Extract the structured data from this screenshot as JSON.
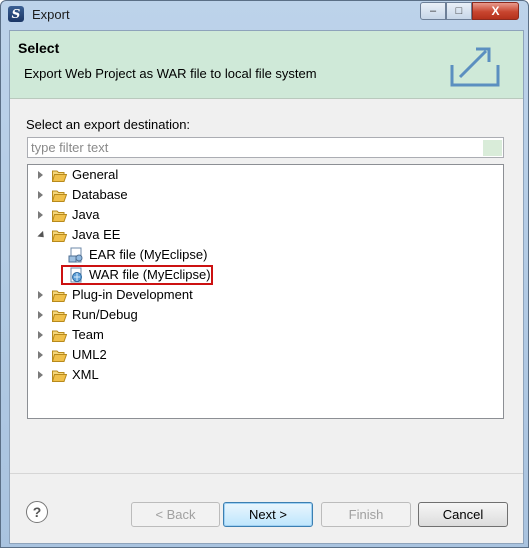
{
  "window": {
    "title": "Export",
    "controls": {
      "minimize": "–",
      "maximize": "□",
      "close": "X"
    }
  },
  "banner": {
    "title": "Select",
    "description": "Export Web Project as WAR file to local file system",
    "icon": "export-icon"
  },
  "destination_label": "Select an export destination:",
  "filter": {
    "placeholder": "type filter text",
    "value": ""
  },
  "tree": [
    {
      "label": "General",
      "kind": "folder",
      "expanded": false
    },
    {
      "label": "Database",
      "kind": "folder",
      "expanded": false
    },
    {
      "label": "Java",
      "kind": "folder",
      "expanded": false
    },
    {
      "label": "Java EE",
      "kind": "folder",
      "expanded": true
    },
    {
      "label": "EAR file (MyEclipse)",
      "kind": "ear",
      "child": true
    },
    {
      "label": "WAR file (MyEclipse)",
      "kind": "war",
      "child": true,
      "selected": true
    },
    {
      "label": "Plug-in Development",
      "kind": "folder",
      "expanded": false
    },
    {
      "label": "Run/Debug",
      "kind": "folder",
      "expanded": false
    },
    {
      "label": "Team",
      "kind": "folder",
      "expanded": false
    },
    {
      "label": "UML2",
      "kind": "folder",
      "expanded": false
    },
    {
      "label": "XML",
      "kind": "folder",
      "expanded": false
    }
  ],
  "buttons": {
    "help": "?",
    "back": "< Back",
    "next": "Next >",
    "finish": "Finish",
    "cancel": "Cancel"
  },
  "colors": {
    "banner": "#cfe9d8",
    "selection_highlight": "#cc1111",
    "folder": "#e8b94a"
  }
}
